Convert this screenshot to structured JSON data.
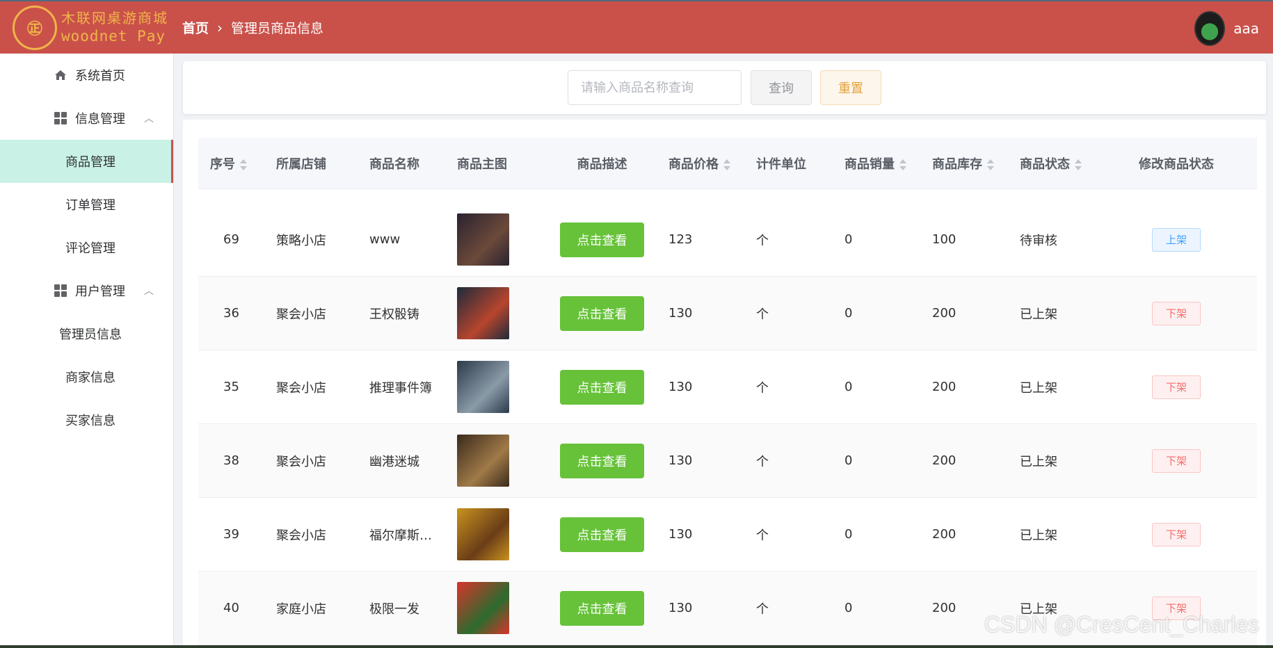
{
  "header": {
    "logo_cn": "木联网桌游商城",
    "logo_en": "woodnet Pay",
    "logo_badge": "㊣",
    "breadcrumb_home": "首页",
    "breadcrumb_sep": "›",
    "breadcrumb_current": "管理员商品信息",
    "user_name": "aaa",
    "bg_color": "#c9514a",
    "logo_color": "#f0b44a"
  },
  "sidebar": {
    "home": "系统首页",
    "info_group": "信息管理",
    "goods": "商品管理",
    "orders": "订单管理",
    "comments": "评论管理",
    "user_group": "用户管理",
    "admin_info": "管理员信息",
    "merchant_info": "商家信息",
    "buyer_info": "买家信息",
    "chevron": "︿"
  },
  "search": {
    "placeholder": "请输入商品名称查询",
    "query_label": "查询",
    "reset_label": "重置"
  },
  "table": {
    "headers": {
      "id": "序号",
      "shop": "所属店铺",
      "name": "商品名称",
      "image": "商品主图",
      "desc": "商品描述",
      "price": "商品价格",
      "unit": "计件单位",
      "sales": "商品销量",
      "stock": "商品库存",
      "status": "商品状态",
      "op": "修改商品状态"
    },
    "rows": [
      {
        "id": "69",
        "shop": "策略小店",
        "name": "www",
        "desc_btn": "点击查看",
        "price": "123",
        "unit": "个",
        "sales": "0",
        "stock": "100",
        "status": "待审核",
        "op": "上架",
        "img_colors": [
          "#2a2230",
          "#6b4a3a"
        ]
      },
      {
        "id": "36",
        "shop": "聚会小店",
        "name": "王权骰铸",
        "desc_btn": "点击查看",
        "price": "130",
        "unit": "个",
        "sales": "0",
        "stock": "200",
        "status": "已上架",
        "op": "下架",
        "img_colors": [
          "#1d2b3a",
          "#b8452e"
        ]
      },
      {
        "id": "35",
        "shop": "聚会小店",
        "name": "推理事件簿",
        "desc_btn": "点击查看",
        "price": "130",
        "unit": "个",
        "sales": "0",
        "stock": "200",
        "status": "已上架",
        "op": "下架",
        "img_colors": [
          "#2c3a4a",
          "#8a9ba8"
        ]
      },
      {
        "id": "38",
        "shop": "聚会小店",
        "name": "幽港迷城",
        "desc_btn": "点击查看",
        "price": "130",
        "unit": "个",
        "sales": "0",
        "stock": "200",
        "status": "已上架",
        "op": "下架",
        "img_colors": [
          "#3a2a1c",
          "#a07a48"
        ]
      },
      {
        "id": "39",
        "shop": "聚会小店",
        "name": "福尔摩斯…",
        "desc_btn": "点击查看",
        "price": "130",
        "unit": "个",
        "sales": "0",
        "stock": "200",
        "status": "已上架",
        "op": "下架",
        "img_colors": [
          "#c9931f",
          "#6a3d17"
        ]
      },
      {
        "id": "40",
        "shop": "家庭小店",
        "name": "极限一发",
        "desc_btn": "点击查看",
        "price": "130",
        "unit": "个",
        "sales": "0",
        "stock": "200",
        "status": "已上架",
        "op": "下架",
        "img_colors": [
          "#d9342b",
          "#2b6b2e"
        ]
      }
    ]
  },
  "watermark": "CSDN @CresCent_Charles"
}
